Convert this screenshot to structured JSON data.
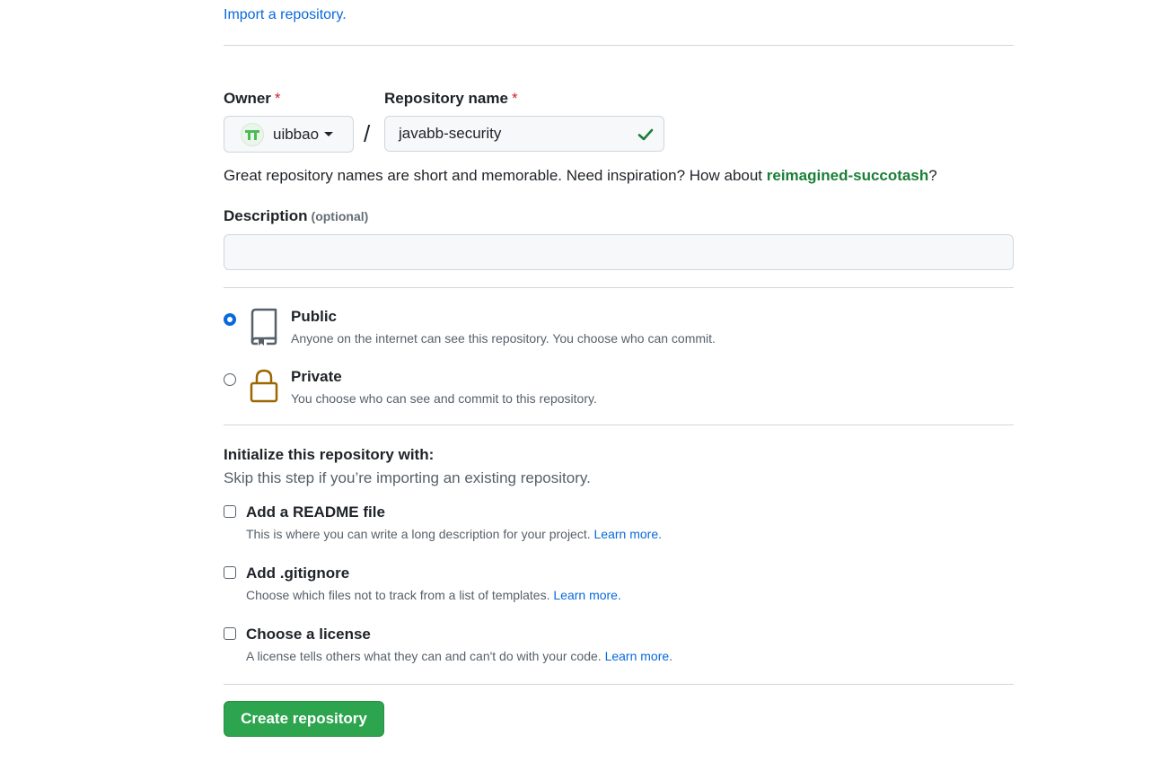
{
  "import": {
    "link": "Import a repository."
  },
  "owner": {
    "label": "Owner",
    "required_mark": "*",
    "name": "uibbao"
  },
  "separator": "/",
  "repository": {
    "label": "Repository name",
    "required_mark": "*",
    "value": "javabb-security"
  },
  "hint": {
    "prefix": "Great repository names are short and memorable. Need inspiration? How about ",
    "suggestion": "reimagined-succotash",
    "suffix": "?"
  },
  "description": {
    "label": "Description",
    "optional": "(optional)",
    "value": ""
  },
  "visibility": {
    "public": {
      "title": "Public",
      "desc": "Anyone on the internet can see this repository. You choose who can commit.",
      "checked": true
    },
    "private": {
      "title": "Private",
      "desc": "You choose who can see and commit to this repository.",
      "checked": false
    }
  },
  "initialize": {
    "title": "Initialize this repository with:",
    "subtitle": "Skip this step if you’re importing an existing repository.",
    "options": [
      {
        "title": "Add a README file",
        "desc": "This is where you can write a long description for your project.",
        "link": "Learn more."
      },
      {
        "title": "Add .gitignore",
        "desc": "Choose which files not to track from a list of templates.",
        "link": "Learn more."
      },
      {
        "title": "Choose a license",
        "desc": "A license tells others what they can and can't do with your code.",
        "link": "Learn more."
      }
    ]
  },
  "create_button": "Create repository",
  "colors": {
    "accent_blue": "#0969da",
    "success_green": "#2da44e",
    "suggestion_green": "#1a7f37",
    "required_red": "#cf222e",
    "lock_gold": "#9a6700"
  }
}
